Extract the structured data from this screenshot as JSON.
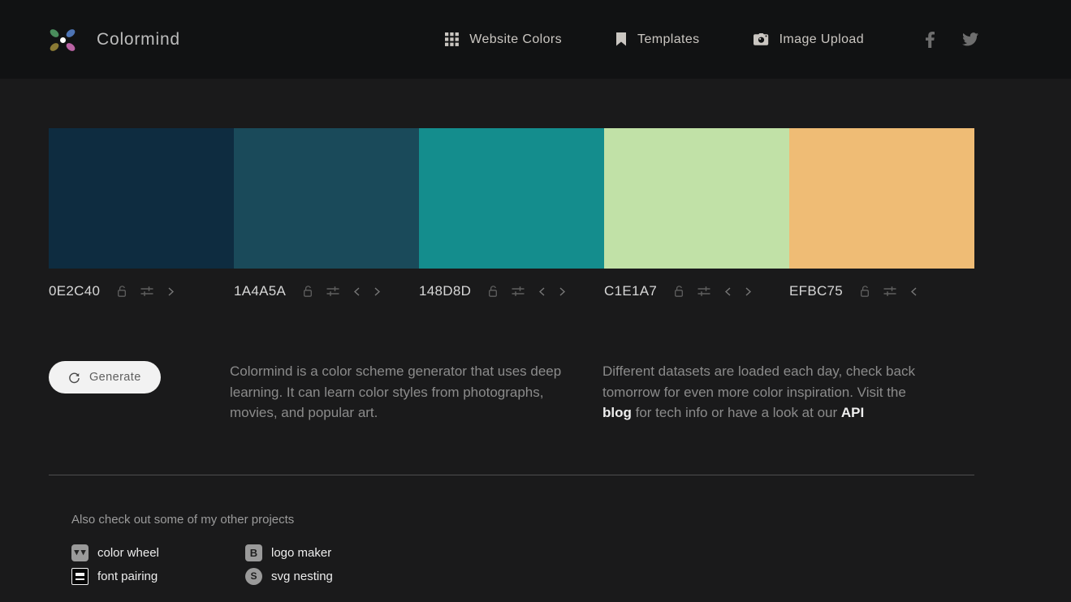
{
  "header": {
    "brand": "Colormind",
    "nav": [
      {
        "label": "Website Colors",
        "icon": "grid-icon"
      },
      {
        "label": "Templates",
        "icon": "bookmark-icon"
      },
      {
        "label": "Image Upload",
        "icon": "camera-icon"
      }
    ],
    "social": [
      {
        "name": "facebook",
        "icon": "facebook-icon"
      },
      {
        "name": "twitter",
        "icon": "twitter-icon"
      }
    ]
  },
  "palette": {
    "swatches": [
      {
        "hex": "0E2C40",
        "color": "#0E2C40"
      },
      {
        "hex": "1A4A5A",
        "color": "#1A4A5A"
      },
      {
        "hex": "148D8D",
        "color": "#148D8D"
      },
      {
        "hex": "C1E1A7",
        "color": "#C1E1A7"
      },
      {
        "hex": "EFBC75",
        "color": "#EFBC75"
      }
    ]
  },
  "generate": {
    "label": "Generate",
    "icon": "refresh-icon"
  },
  "about": {
    "intro": "Colormind is a color scheme generator that uses deep learning. It can learn color styles from photographs, movies, and popular art.",
    "datasets_part1": "Different datasets are loaded each day, check back tomorrow for even more color inspiration. Visit the ",
    "blog_link": "blog",
    "datasets_part2": " for tech info or have a look at our ",
    "api_link": "API"
  },
  "footer": {
    "heading": "Also check out some of my other projects",
    "projects": [
      {
        "label": "color wheel",
        "icon": "color-wheel-icon"
      },
      {
        "label": "font pairing",
        "icon": "font-pairing-icon"
      },
      {
        "label": "logo maker",
        "icon": "logo-maker-icon",
        "icon_glyph": "B"
      },
      {
        "label": "svg nesting",
        "icon": "svg-nesting-icon",
        "icon_glyph": "S"
      }
    ]
  },
  "theme": {
    "header_bg": "#111213",
    "body_bg": "#1a1a1b",
    "text_muted": "#8b8b8b",
    "hex_text": "#d7d7d7",
    "link_text": "#eeeeee",
    "divider": "#4e4e4e",
    "button_bg": "#f2f2f2"
  }
}
